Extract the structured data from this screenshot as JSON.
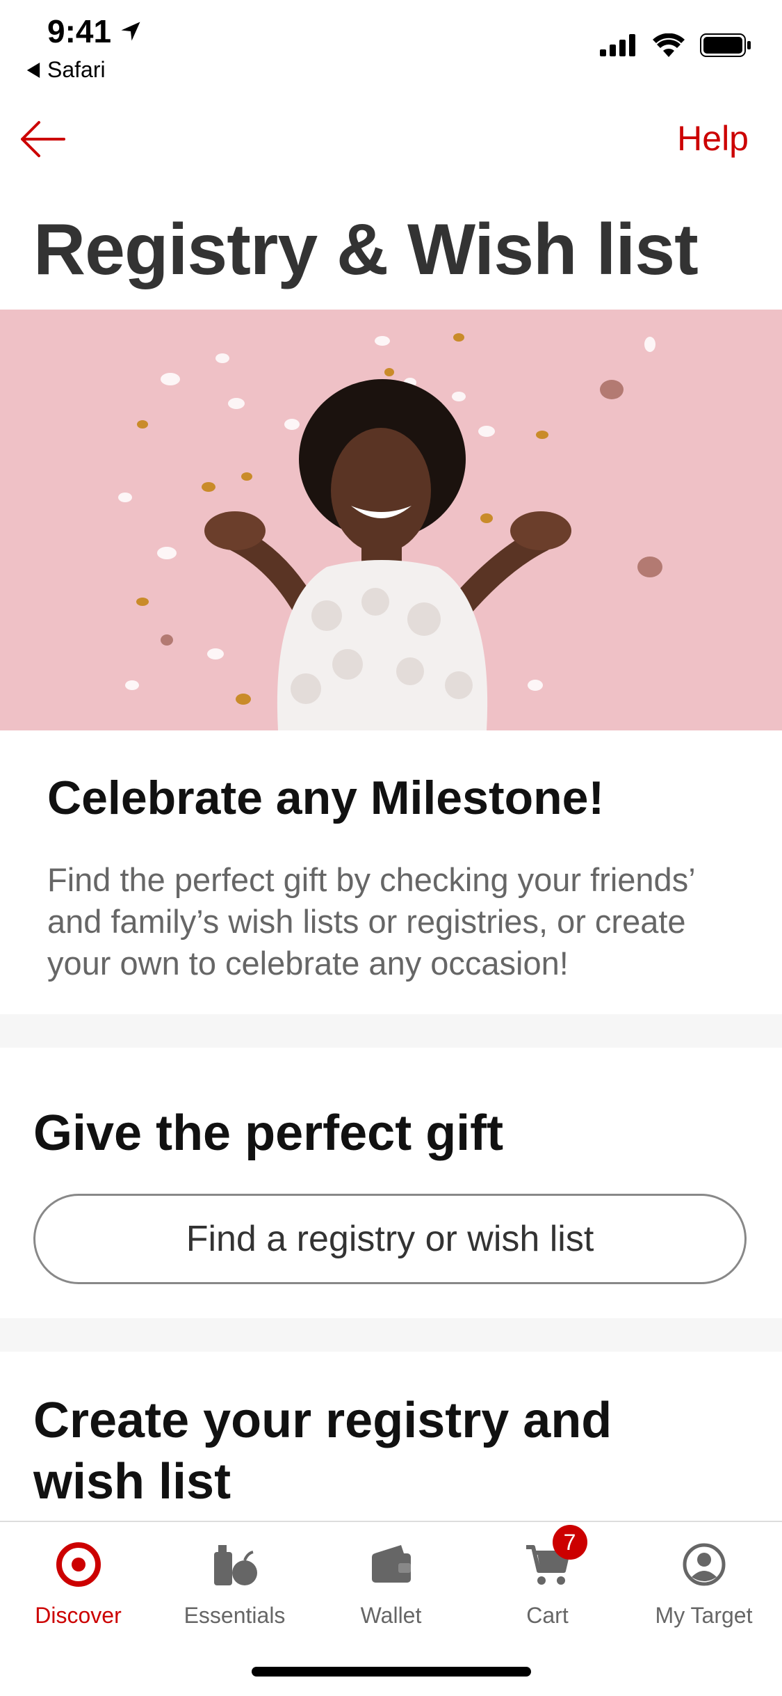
{
  "status_bar": {
    "time": "9:41",
    "back_app_label": "Safari"
  },
  "nav": {
    "back_icon": "arrow-left-icon",
    "help_label": "Help"
  },
  "page": {
    "title": "Registry & Wish list"
  },
  "hero": {
    "image_semantic": "woman-celebrating-with-confetti",
    "background_color": "#efc1c6"
  },
  "celebrate": {
    "title": "Celebrate any Milestone!",
    "description": "Find the perfect gift by checking your friends’ and family’s wish lists or registries, or create your own to celebrate any occasion!"
  },
  "give": {
    "title": "Give the perfect gift",
    "button_label": "Find a registry or wish list"
  },
  "create": {
    "title": "Create your registry and wish list"
  },
  "tabbar": {
    "tabs": [
      {
        "label": "Discover",
        "icon": "target-bullseye-icon",
        "active": true
      },
      {
        "label": "Essentials",
        "icon": "essentials-icon",
        "active": false
      },
      {
        "label": "Wallet",
        "icon": "wallet-icon",
        "active": false
      },
      {
        "label": "Cart",
        "icon": "cart-icon",
        "active": false,
        "badge": "7"
      },
      {
        "label": "My Target",
        "icon": "profile-icon",
        "active": false
      }
    ]
  },
  "colors": {
    "accent": "#cc0000",
    "text_muted": "#666666"
  }
}
